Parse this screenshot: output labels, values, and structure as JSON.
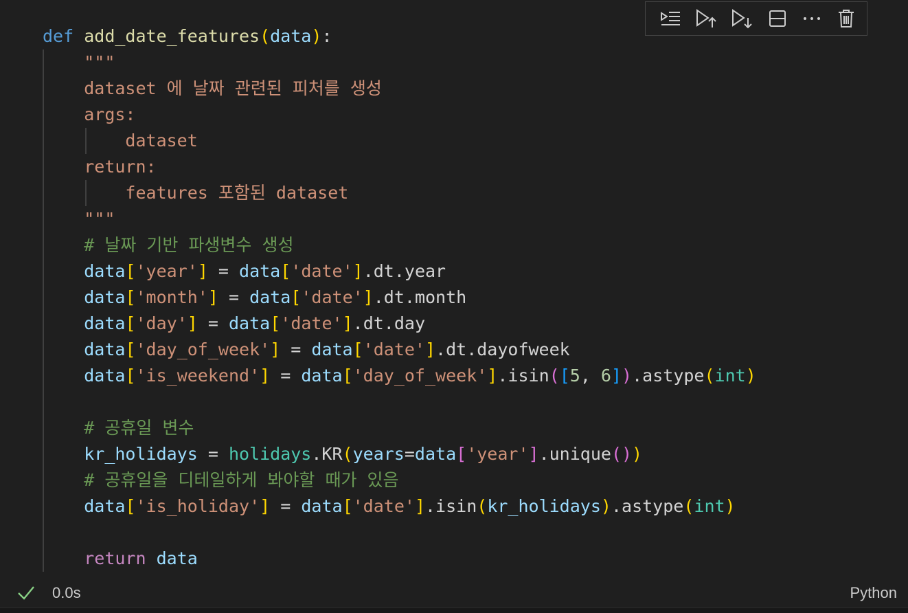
{
  "cell": {
    "language": "Python",
    "execution_time": "0.0s",
    "status": "success",
    "status_icon": "check-icon",
    "code_lines": [
      [
        {
          "t": "def",
          "c": "keyword"
        },
        {
          "t": " ",
          "c": "punct"
        },
        {
          "t": "add_date_features",
          "c": "function"
        },
        {
          "t": "(",
          "c": "bracket1"
        },
        {
          "t": "data",
          "c": "param"
        },
        {
          "t": ")",
          "c": "bracket1"
        },
        {
          "t": ":",
          "c": "punct"
        }
      ],
      [
        {
          "t": "    ",
          "c": "punct"
        },
        {
          "t": "\"\"\"",
          "c": "string"
        }
      ],
      [
        {
          "t": "    ",
          "c": "punct"
        },
        {
          "t": "dataset 에 날짜 관련된 피처를 생성",
          "c": "string"
        }
      ],
      [
        {
          "t": "    ",
          "c": "punct"
        },
        {
          "t": "args:",
          "c": "string"
        }
      ],
      [
        {
          "t": "        ",
          "c": "punct"
        },
        {
          "t": "dataset",
          "c": "string"
        }
      ],
      [
        {
          "t": "    ",
          "c": "punct"
        },
        {
          "t": "return:",
          "c": "string"
        }
      ],
      [
        {
          "t": "        ",
          "c": "punct"
        },
        {
          "t": "features 포함된 dataset",
          "c": "string"
        }
      ],
      [
        {
          "t": "    ",
          "c": "punct"
        },
        {
          "t": "\"\"\"",
          "c": "string"
        }
      ],
      [
        {
          "t": "    ",
          "c": "punct"
        },
        {
          "t": "# 날짜 기반 파생변수 생성",
          "c": "comment"
        }
      ],
      [
        {
          "t": "    ",
          "c": "punct"
        },
        {
          "t": "data",
          "c": "variable"
        },
        {
          "t": "[",
          "c": "bracket1"
        },
        {
          "t": "'year'",
          "c": "string"
        },
        {
          "t": "]",
          "c": "bracket1"
        },
        {
          "t": " = ",
          "c": "operator"
        },
        {
          "t": "data",
          "c": "variable"
        },
        {
          "t": "[",
          "c": "bracket1"
        },
        {
          "t": "'date'",
          "c": "string"
        },
        {
          "t": "]",
          "c": "bracket1"
        },
        {
          "t": ".dt.year",
          "c": "punct"
        }
      ],
      [
        {
          "t": "    ",
          "c": "punct"
        },
        {
          "t": "data",
          "c": "variable"
        },
        {
          "t": "[",
          "c": "bracket1"
        },
        {
          "t": "'month'",
          "c": "string"
        },
        {
          "t": "]",
          "c": "bracket1"
        },
        {
          "t": " = ",
          "c": "operator"
        },
        {
          "t": "data",
          "c": "variable"
        },
        {
          "t": "[",
          "c": "bracket1"
        },
        {
          "t": "'date'",
          "c": "string"
        },
        {
          "t": "]",
          "c": "bracket1"
        },
        {
          "t": ".dt.month",
          "c": "punct"
        }
      ],
      [
        {
          "t": "    ",
          "c": "punct"
        },
        {
          "t": "data",
          "c": "variable"
        },
        {
          "t": "[",
          "c": "bracket1"
        },
        {
          "t": "'day'",
          "c": "string"
        },
        {
          "t": "]",
          "c": "bracket1"
        },
        {
          "t": " = ",
          "c": "operator"
        },
        {
          "t": "data",
          "c": "variable"
        },
        {
          "t": "[",
          "c": "bracket1"
        },
        {
          "t": "'date'",
          "c": "string"
        },
        {
          "t": "]",
          "c": "bracket1"
        },
        {
          "t": ".dt.day",
          "c": "punct"
        }
      ],
      [
        {
          "t": "    ",
          "c": "punct"
        },
        {
          "t": "data",
          "c": "variable"
        },
        {
          "t": "[",
          "c": "bracket1"
        },
        {
          "t": "'day_of_week'",
          "c": "string"
        },
        {
          "t": "]",
          "c": "bracket1"
        },
        {
          "t": " = ",
          "c": "operator"
        },
        {
          "t": "data",
          "c": "variable"
        },
        {
          "t": "[",
          "c": "bracket1"
        },
        {
          "t": "'date'",
          "c": "string"
        },
        {
          "t": "]",
          "c": "bracket1"
        },
        {
          "t": ".dt.dayofweek",
          "c": "punct"
        }
      ],
      [
        {
          "t": "    ",
          "c": "punct"
        },
        {
          "t": "data",
          "c": "variable"
        },
        {
          "t": "[",
          "c": "bracket1"
        },
        {
          "t": "'is_weekend'",
          "c": "string"
        },
        {
          "t": "]",
          "c": "bracket1"
        },
        {
          "t": " = ",
          "c": "operator"
        },
        {
          "t": "data",
          "c": "variable"
        },
        {
          "t": "[",
          "c": "bracket1"
        },
        {
          "t": "'day_of_week'",
          "c": "string"
        },
        {
          "t": "]",
          "c": "bracket1"
        },
        {
          "t": ".isin",
          "c": "punct"
        },
        {
          "t": "(",
          "c": "bracket2"
        },
        {
          "t": "[",
          "c": "bracket3"
        },
        {
          "t": "5",
          "c": "number"
        },
        {
          "t": ", ",
          "c": "punct"
        },
        {
          "t": "6",
          "c": "number"
        },
        {
          "t": "]",
          "c": "bracket3"
        },
        {
          "t": ")",
          "c": "bracket2"
        },
        {
          "t": ".astype",
          "c": "punct"
        },
        {
          "t": "(",
          "c": "bracket1"
        },
        {
          "t": "int",
          "c": "builtin"
        },
        {
          "t": ")",
          "c": "bracket1"
        }
      ],
      [],
      [
        {
          "t": "    ",
          "c": "punct"
        },
        {
          "t": "# 공휴일 변수",
          "c": "comment"
        }
      ],
      [
        {
          "t": "    ",
          "c": "punct"
        },
        {
          "t": "kr_holidays",
          "c": "variable"
        },
        {
          "t": " = ",
          "c": "operator"
        },
        {
          "t": "holidays",
          "c": "builtin"
        },
        {
          "t": ".KR",
          "c": "punct"
        },
        {
          "t": "(",
          "c": "bracket1"
        },
        {
          "t": "years",
          "c": "param"
        },
        {
          "t": "=",
          "c": "operator"
        },
        {
          "t": "data",
          "c": "variable"
        },
        {
          "t": "[",
          "c": "bracket2"
        },
        {
          "t": "'year'",
          "c": "string"
        },
        {
          "t": "]",
          "c": "bracket2"
        },
        {
          "t": ".unique",
          "c": "punct"
        },
        {
          "t": "()",
          "c": "bracket2"
        },
        {
          "t": ")",
          "c": "bracket1"
        }
      ],
      [
        {
          "t": "    ",
          "c": "punct"
        },
        {
          "t": "# 공휴일을 디테일하게 봐야할 때가 있음",
          "c": "comment"
        }
      ],
      [
        {
          "t": "    ",
          "c": "punct"
        },
        {
          "t": "data",
          "c": "variable"
        },
        {
          "t": "[",
          "c": "bracket1"
        },
        {
          "t": "'is_holiday'",
          "c": "string"
        },
        {
          "t": "]",
          "c": "bracket1"
        },
        {
          "t": " = ",
          "c": "operator"
        },
        {
          "t": "data",
          "c": "variable"
        },
        {
          "t": "[",
          "c": "bracket1"
        },
        {
          "t": "'date'",
          "c": "string"
        },
        {
          "t": "]",
          "c": "bracket1"
        },
        {
          "t": ".isin",
          "c": "punct"
        },
        {
          "t": "(",
          "c": "bracket1"
        },
        {
          "t": "kr_holidays",
          "c": "variable"
        },
        {
          "t": ")",
          "c": "bracket1"
        },
        {
          "t": ".astype",
          "c": "punct"
        },
        {
          "t": "(",
          "c": "bracket1"
        },
        {
          "t": "int",
          "c": "builtin"
        },
        {
          "t": ")",
          "c": "bracket1"
        }
      ],
      [],
      [
        {
          "t": "    ",
          "c": "punct"
        },
        {
          "t": "return",
          "c": "control"
        },
        {
          "t": " ",
          "c": "punct"
        },
        {
          "t": "data",
          "c": "variable"
        }
      ]
    ]
  },
  "toolbar": {
    "buttons": [
      {
        "name": "run-by-line-button",
        "icon": "run-by-line-icon"
      },
      {
        "name": "execute-above-button",
        "icon": "execute-above-icon"
      },
      {
        "name": "execute-below-button",
        "icon": "execute-below-icon"
      },
      {
        "name": "split-cell-button",
        "icon": "split-cell-icon"
      },
      {
        "name": "more-actions-button",
        "icon": "ellipsis-icon"
      },
      {
        "name": "delete-cell-button",
        "icon": "trash-icon"
      }
    ]
  },
  "colors": {
    "background": "#1f1f1f",
    "success_check": "#89d185"
  }
}
